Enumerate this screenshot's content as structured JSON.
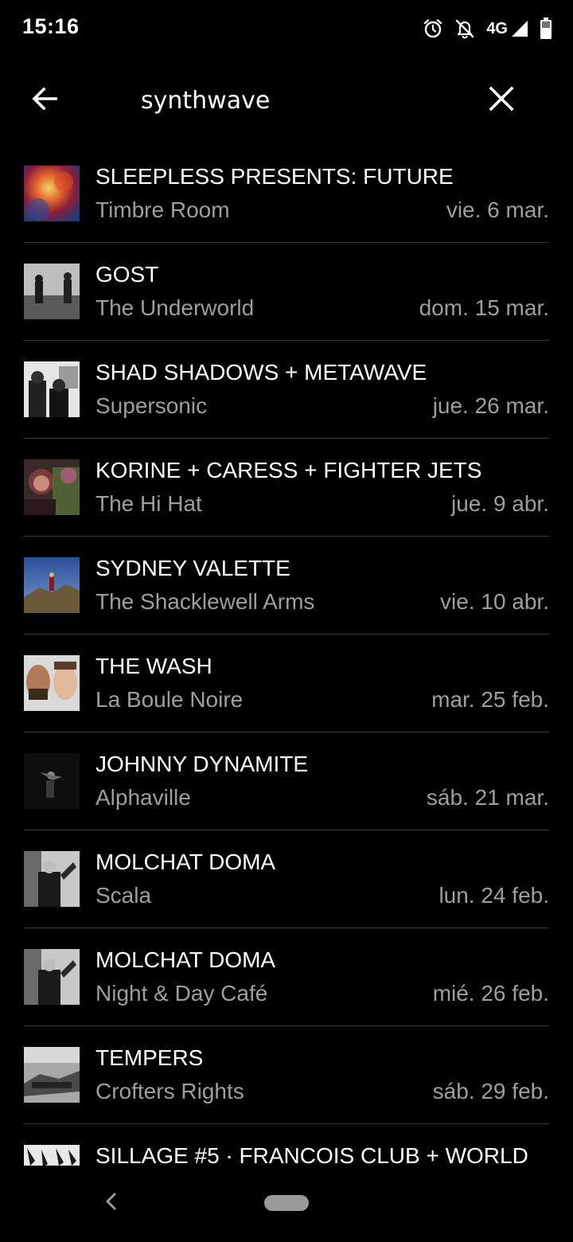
{
  "status_bar": {
    "time": "15:16",
    "network": "4G",
    "icons": [
      "alarm-icon",
      "notifications-off-icon",
      "signal-icon",
      "battery-icon"
    ]
  },
  "search": {
    "query": "synthwave",
    "back_icon": "arrow-left-icon",
    "clear_icon": "close-icon"
  },
  "results": [
    {
      "title": "SLEEPLESS PRESENTS: FUTURE",
      "venue": "Timbre Room",
      "date": "vie. 6 mar."
    },
    {
      "title": "GOST",
      "venue": "The Underworld",
      "date": "dom. 15 mar."
    },
    {
      "title": "SHAD SHADOWS + METAWAVE",
      "venue": "Supersonic",
      "date": "jue. 26 mar."
    },
    {
      "title": "KORINE + CARESS + FIGHTER JETS",
      "venue": "The Hi Hat",
      "date": "jue. 9 abr."
    },
    {
      "title": "SYDNEY VALETTE",
      "venue": "The Shacklewell Arms",
      "date": "vie. 10 abr."
    },
    {
      "title": "THE WASH",
      "venue": "La Boule Noire",
      "date": "mar. 25 feb."
    },
    {
      "title": "JOHNNY DYNAMITE",
      "venue": "Alphaville",
      "date": "sáb. 21 mar."
    },
    {
      "title": "MOLCHAT DOMA",
      "venue": "Scala",
      "date": "lun. 24 feb."
    },
    {
      "title": "MOLCHAT DOMA",
      "venue": "Night & Day Café",
      "date": "mié. 26 feb."
    },
    {
      "title": "TEMPERS",
      "venue": "Crofters Rights",
      "date": "sáb. 29 feb."
    },
    {
      "title": "SILLAGE #5 · FRANCOIS CLUB + WORLD",
      "venue": "",
      "date": ""
    }
  ],
  "nav_bar": {
    "back_icon": "nav-back-icon",
    "home_icon": "home-pill-icon"
  },
  "colors": {
    "background": "#000000",
    "primary_text": "#ffffff",
    "secondary_text": "#9e9e9e",
    "divider": "#3a3a3a"
  }
}
